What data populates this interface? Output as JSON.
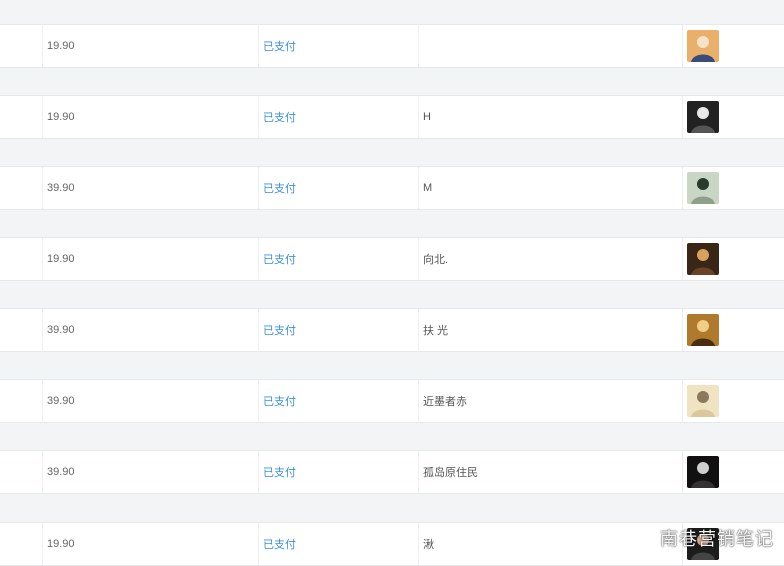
{
  "orders": [
    {
      "amount": "19.90",
      "status": "已支付",
      "nickname": "",
      "avatar": "avatar-photo-icon",
      "avatar_colors": [
        "#e8b06a",
        "#f4e3c8",
        "#3a4a7a"
      ]
    },
    {
      "amount": "19.90",
      "status": "已支付",
      "nickname": "H",
      "avatar": "avatar-photo-icon",
      "avatar_colors": [
        "#222222",
        "#e8e8e8",
        "#555555"
      ]
    },
    {
      "amount": "39.90",
      "status": "已支付",
      "nickname": "M",
      "avatar": "avatar-photo-icon",
      "avatar_colors": [
        "#c9d6c4",
        "#2c3a2c",
        "#8ea08a"
      ]
    },
    {
      "amount": "19.90",
      "status": "已支付",
      "nickname": "向北.",
      "avatar": "avatar-photo-icon",
      "avatar_colors": [
        "#3a2617",
        "#d8a25c",
        "#6b4226"
      ]
    },
    {
      "amount": "39.90",
      "status": "已支付",
      "nickname": "扶 光",
      "avatar": "avatar-photo-icon",
      "avatar_colors": [
        "#b07a2e",
        "#f0cf85",
        "#4a2e10"
      ]
    },
    {
      "amount": "39.90",
      "status": "已支付",
      "nickname": "近墨者赤",
      "avatar": "avatar-photo-icon",
      "avatar_colors": [
        "#efe3c2",
        "#8a7a5a",
        "#d9c89a"
      ]
    },
    {
      "amount": "39.90",
      "status": "已支付",
      "nickname": "孤岛原住民",
      "avatar": "avatar-photo-icon",
      "avatar_colors": [
        "#111111",
        "#cfcfcf",
        "#333333"
      ]
    },
    {
      "amount": "19.90",
      "status": "已支付",
      "nickname": "湫",
      "avatar": "avatar-photo-icon",
      "avatar_colors": [
        "#1c1c1c",
        "#d7a88a",
        "#444444"
      ]
    }
  ],
  "watermark": {
    "text": "南巷营销笔记",
    "icon": "wechat-icon"
  }
}
